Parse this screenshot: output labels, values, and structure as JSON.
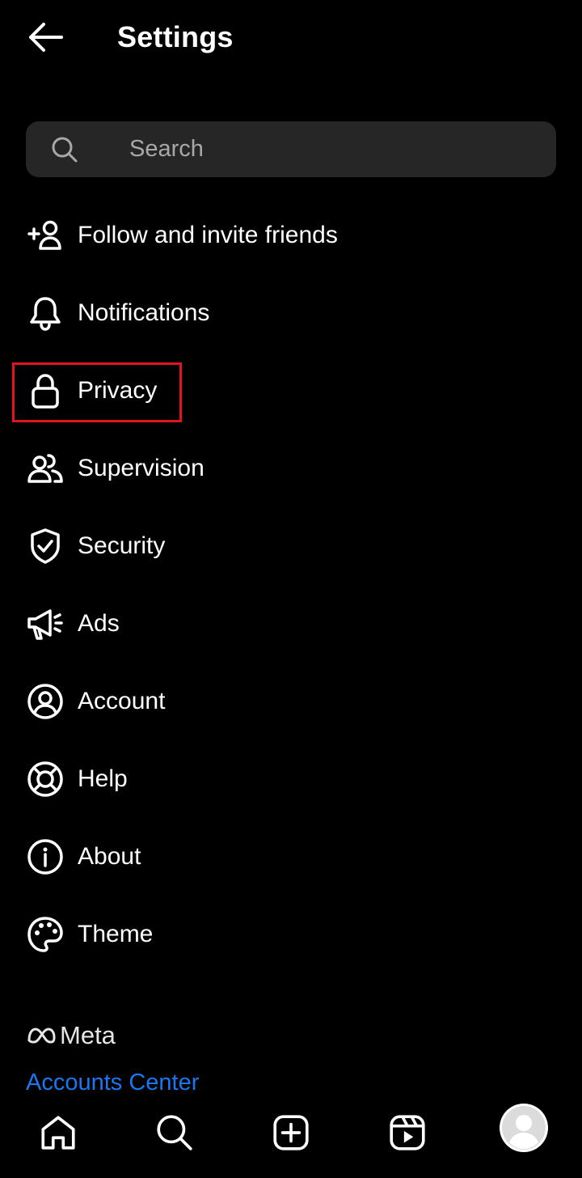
{
  "header": {
    "title": "Settings",
    "back_icon": "arrow-left-icon"
  },
  "search": {
    "placeholder": "Search",
    "value": "",
    "icon": "search-icon"
  },
  "menu": {
    "items": [
      {
        "label": "Follow and invite friends",
        "icon": "add-person-icon"
      },
      {
        "label": "Notifications",
        "icon": "bell-icon"
      },
      {
        "label": "Privacy",
        "icon": "lock-icon",
        "highlighted": true
      },
      {
        "label": "Supervision",
        "icon": "people-icon"
      },
      {
        "label": "Security",
        "icon": "shield-check-icon"
      },
      {
        "label": "Ads",
        "icon": "megaphone-icon"
      },
      {
        "label": "Account",
        "icon": "user-circle-icon"
      },
      {
        "label": "Help",
        "icon": "lifebuoy-icon"
      },
      {
        "label": "About",
        "icon": "info-icon"
      },
      {
        "label": "Theme",
        "icon": "palette-icon"
      }
    ]
  },
  "footer": {
    "brand": "Meta",
    "accounts_center": "Accounts Center"
  },
  "bottom_nav": {
    "items": [
      "home-icon",
      "search-icon",
      "create-icon",
      "reels-icon",
      "profile-avatar"
    ]
  },
  "colors": {
    "background": "#000000",
    "search_bg": "#262626",
    "link": "#1877f2",
    "highlight": "#e3141c"
  }
}
